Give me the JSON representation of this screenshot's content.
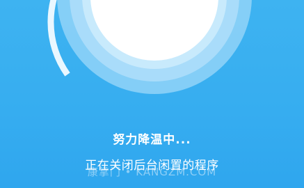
{
  "status": {
    "title": "努力降温中...",
    "subtitle": "正在关闭后台闲置的程序"
  },
  "watermark": {
    "text": "康掌门 • KANGZM.COM"
  },
  "colors": {
    "background": "#36adf0",
    "ring_outer": "#8fd2f8",
    "ring_inner": "#b9e3fb",
    "core": "#ffffff"
  },
  "icons": {
    "gauge": "cooling-gauge-icon"
  }
}
